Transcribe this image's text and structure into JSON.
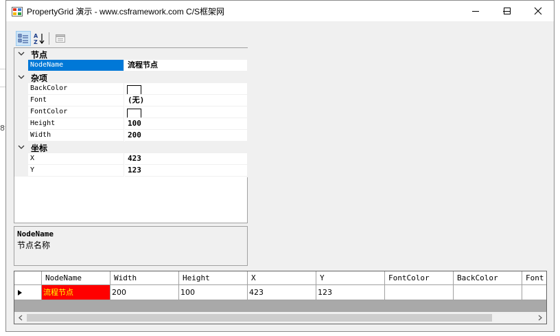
{
  "window": {
    "title": "PropertyGrid 演示 - www.csframework.com C/S框架网"
  },
  "toolbar": {
    "categorized_icon": "categorized-icon",
    "alphabetical_icon": "sort-az-icon",
    "property_pages_icon": "property-pages-icon"
  },
  "property_grid": {
    "categories": [
      {
        "name": "节点",
        "rows": [
          {
            "name": "NodeName",
            "value": "流程节点"
          }
        ]
      },
      {
        "name": "杂项",
        "rows": [
          {
            "name": "BackColor",
            "value": ""
          },
          {
            "name": "Font",
            "value": "(无)"
          },
          {
            "name": "FontColor",
            "value": ""
          },
          {
            "name": "Height",
            "value": "100"
          },
          {
            "name": "Width",
            "value": "200"
          }
        ]
      },
      {
        "name": "坐标",
        "rows": [
          {
            "name": "X",
            "value": "423"
          },
          {
            "name": "Y",
            "value": "123"
          }
        ]
      }
    ]
  },
  "help": {
    "name": "NodeName",
    "description": "节点名称"
  },
  "data_grid": {
    "columns": [
      "NodeName",
      "Width",
      "Height",
      "X",
      "Y",
      "FontColor",
      "BackColor",
      "Font"
    ],
    "rows": [
      [
        "流程节点",
        "200",
        "100",
        "423",
        "123",
        "",
        "",
        ""
      ]
    ]
  },
  "colors": {
    "selection": "#0078d7",
    "node_cell_background": "#ff0000",
    "node_cell_text": "#ffff00",
    "grid_background": "#a9a9a9"
  },
  "background_fragment": "8"
}
